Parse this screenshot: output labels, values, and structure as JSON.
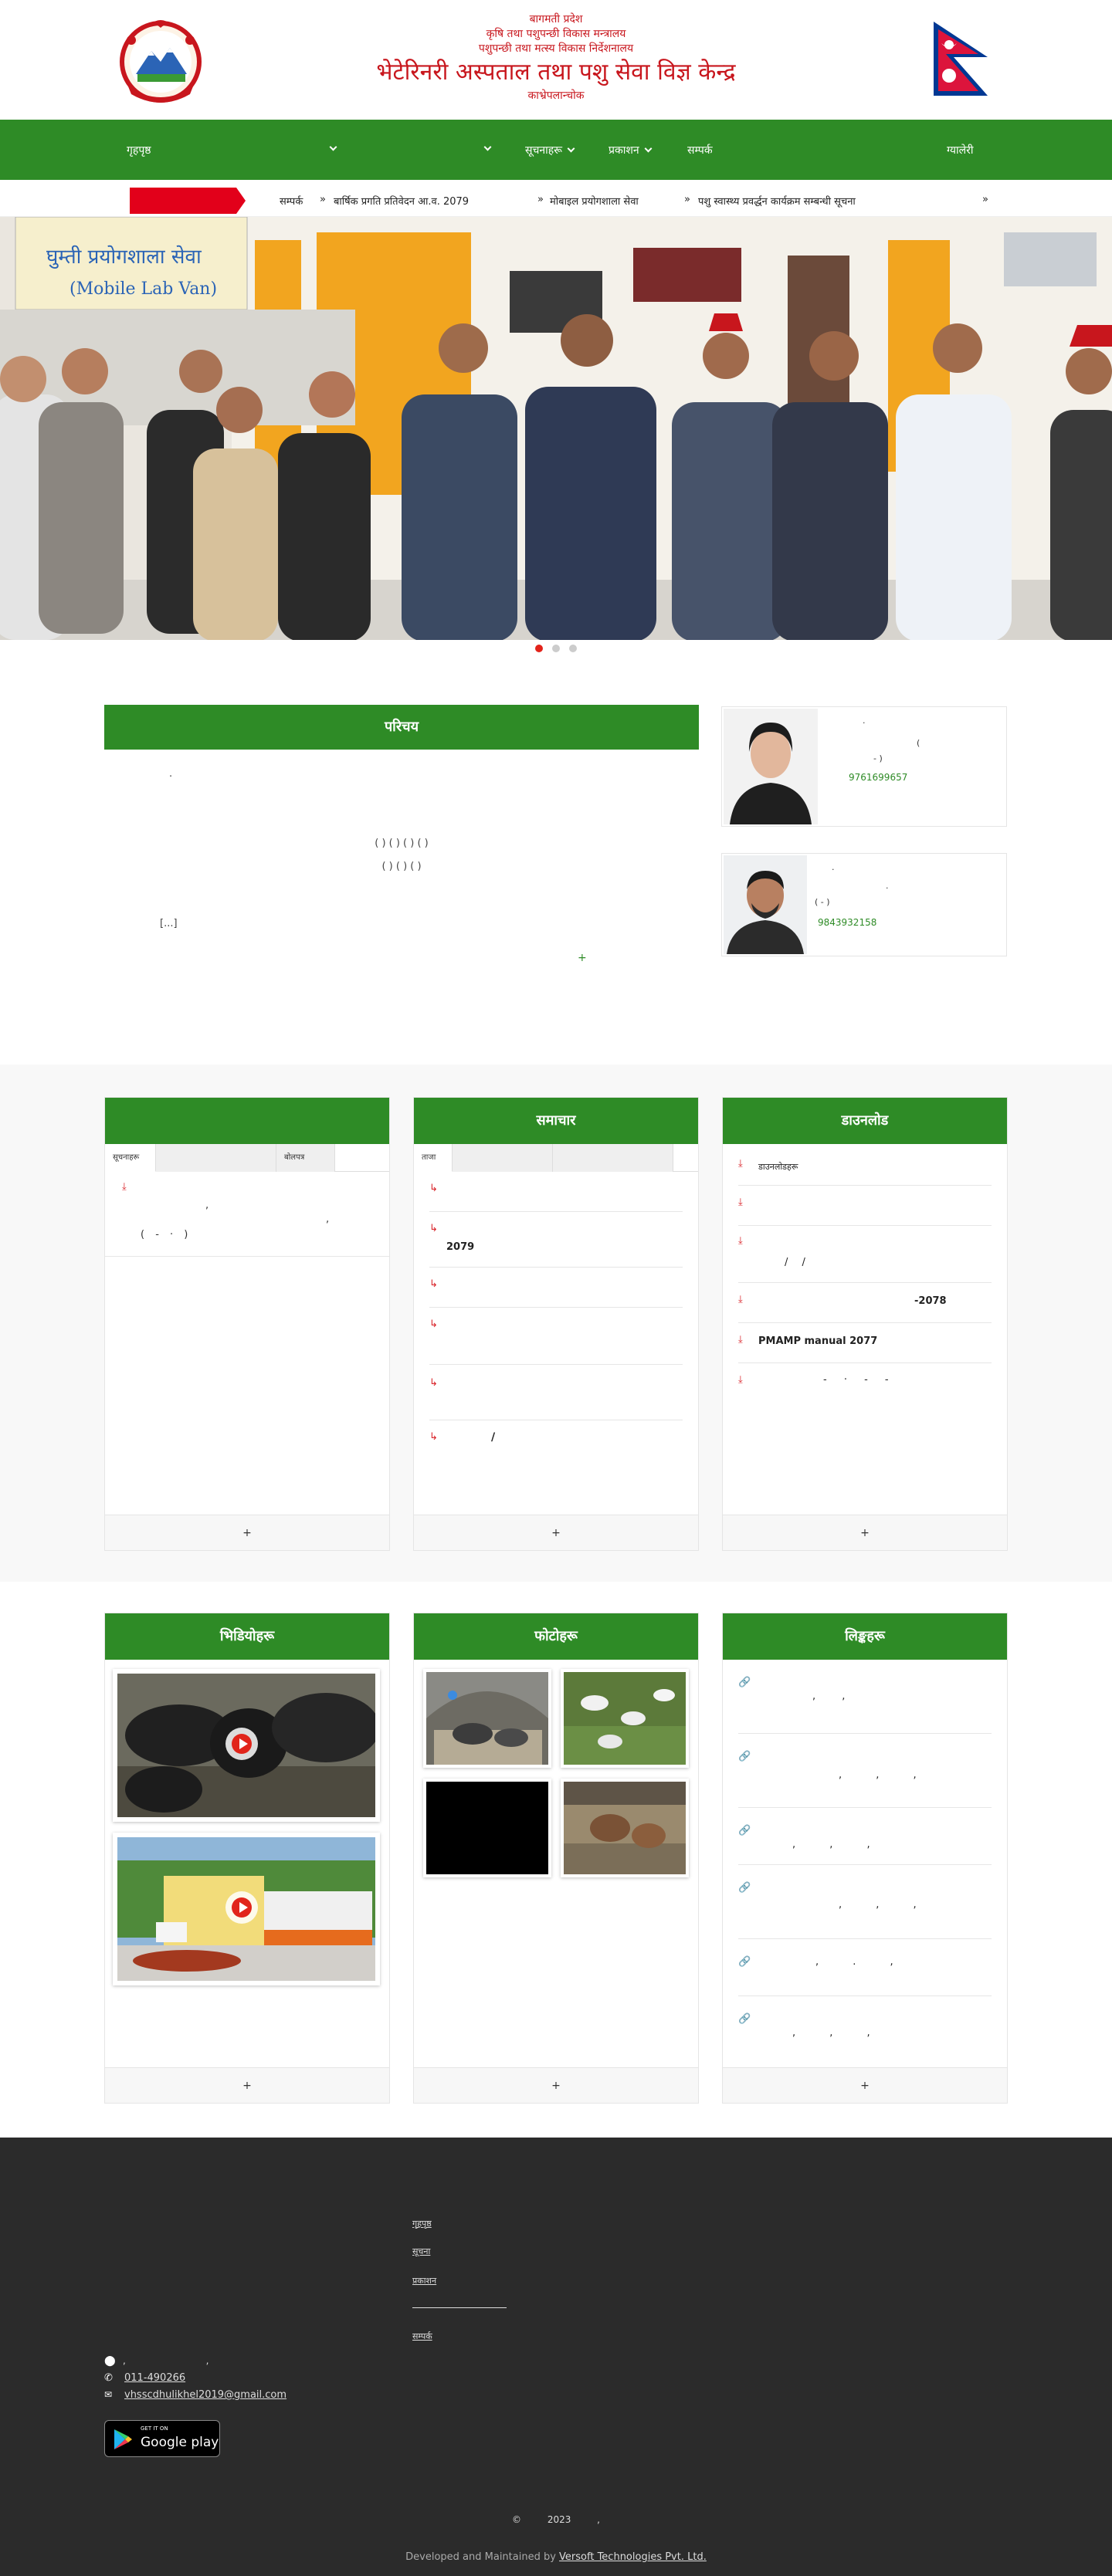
{
  "header": {
    "line1": "बागमती प्रदेश",
    "line2": "कृषि तथा पशुपन्छी विकास मन्त्रालय",
    "line3": "पशुपन्छी तथा मत्स्य विकास निर्देशनालय",
    "title": "भेटेरिनरी अस्पताल तथा पशु सेवा विज्ञ केन्द्र",
    "location": "काभ्रेपलान्चोक"
  },
  "nav": {
    "home": "गृहपृष्ठ",
    "item2": "",
    "item3": "",
    "item4": "सूचनाहरू",
    "item5": "प्रकाशन",
    "item6": "सम्पर्क",
    "item7": "ग्यालेरी"
  },
  "ticker": {
    "items": [
      "सम्पर्क",
      "बार्षिक प्रगति प्रतिवेदन आ.व. 2079",
      "मोबाइल प्रयोगशाला सेवा",
      "पशु स्वास्थ्य प्रवर्द्धन कार्यक्रम सम्बन्धी सूचना"
    ]
  },
  "intro": {
    "title": "परिचय",
    "para1": ".",
    "para2": "( ) ( ) ( ) ( )",
    "para3": "( ) ( ) ( )",
    "readmore": "[...]",
    "plus": "+"
  },
  "staff": [
    {
      "line1": "·",
      "line2": "(",
      "line3": "- )",
      "phone": "9761699657"
    },
    {
      "line1": "·",
      "line2": "·",
      "line3": "( - )",
      "phone": "9843932158"
    }
  ],
  "notices": {
    "title": "",
    "tab1": "सूचनाहरू",
    "tab2": "बोलपत्र",
    "item_line1": ",",
    "item_line2": ",",
    "item_line3": "( - · )",
    "more": "+"
  },
  "news": {
    "title": "समाचार",
    "tab1": "ताजा",
    "items": [
      "",
      "2079",
      "",
      "",
      "",
      "/"
    ],
    "more": "+"
  },
  "downloads": {
    "title": "डाउनलोड",
    "items": [
      "डाउनलोडहरू",
      "",
      "/ /",
      "-2078",
      "PMAMP manual 2077",
      "- · - -"
    ],
    "more": "+"
  },
  "videos": {
    "title": "भिडियोहरू",
    "more": "+"
  },
  "gallery": {
    "title": "फोटोहरू",
    "more": "+"
  },
  "links": {
    "title": "लिङ्कहरू",
    "items": [
      ", ,",
      ", , ,",
      ", , ,",
      ", , ,",
      ", . ,",
      ", , ,"
    ],
    "more": "+"
  },
  "footer": {
    "links": [
      "गृहपृष्ठ",
      "सूचना",
      "प्रकाशन",
      "सम्पर्क"
    ],
    "address": ", ,",
    "phone": "011-490266",
    "email": "vhsscdhulikhel2019@gmail.com",
    "google_play_small": "GET IT ON",
    "google_play": "Google play",
    "copyright": "© 2023 ,",
    "developed_by": "Developed and Maintained by",
    "developer": "Versoft Technologies Pvt. Ltd."
  }
}
